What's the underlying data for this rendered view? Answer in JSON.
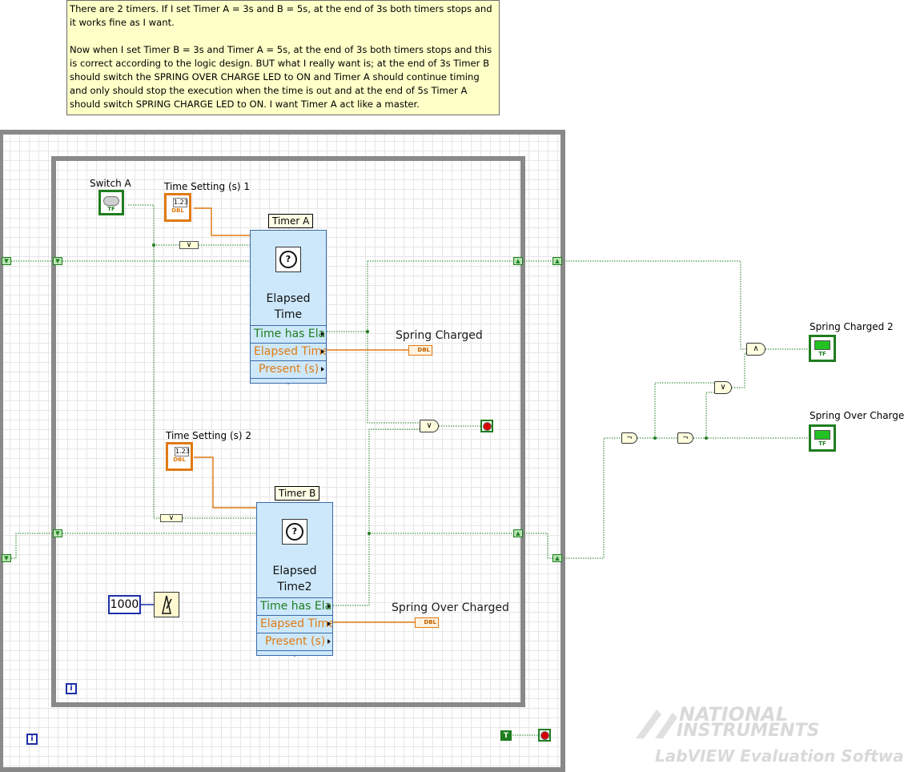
{
  "comment": {
    "paragraph1": "There are 2 timers. If I set Timer A = 3s and B = 5s, at the end of 3s both timers stops and it works fine as I want.",
    "paragraph2": "Now when I set Timer B = 3s and Timer A = 5s, at the end of 3s both timers stops and this is correct according to the logic design. BUT what I really want is; at the end of 3s Timer B should switch the SPRING OVER CHARGE LED to ON and Timer A should continue timing and only should stop the execution when the time is out and at the end of 5s Timer A should switch SPRING CHARGE LED to ON. I want Timer A act like a master."
  },
  "labels": {
    "switch_a": "Switch A",
    "time_setting_1": "Time Setting (s) 1",
    "time_setting_2": "Time Setting (s) 2",
    "timer_a": "Timer A",
    "timer_b": "Timer B",
    "spring_charged": "Spring Charged",
    "spring_over_charged": "Spring Over Charged",
    "spring_charged_2": "Spring Charged 2",
    "spring_over_charge": "Spring Over Charge"
  },
  "timer_a_vi": {
    "title_line1": "Elapsed",
    "title_line2": "Time",
    "out_time_elapsed": "Time has Elap",
    "out_elapsed_time": "Elapsed Time",
    "out_present": "Present (s)"
  },
  "timer_b_vi": {
    "title_line1": "Elapsed",
    "title_line2": "Time2",
    "out_time_elapsed": "Time has Elap",
    "out_elapsed_time": "Elapsed Time",
    "out_present": "Present (s)"
  },
  "constants": {
    "wait_ms": "1000",
    "num_terminal": "1.23",
    "dbl": "DBL",
    "tf": "TF",
    "true_const": "T",
    "iteration": "i"
  },
  "gates": {
    "and": "∧",
    "or": "∨",
    "not": "¬"
  },
  "watermark": {
    "line1": "NATIONAL",
    "line2": "INSTRUMENTS",
    "line3": "LabVIEW Evaluation Software"
  }
}
